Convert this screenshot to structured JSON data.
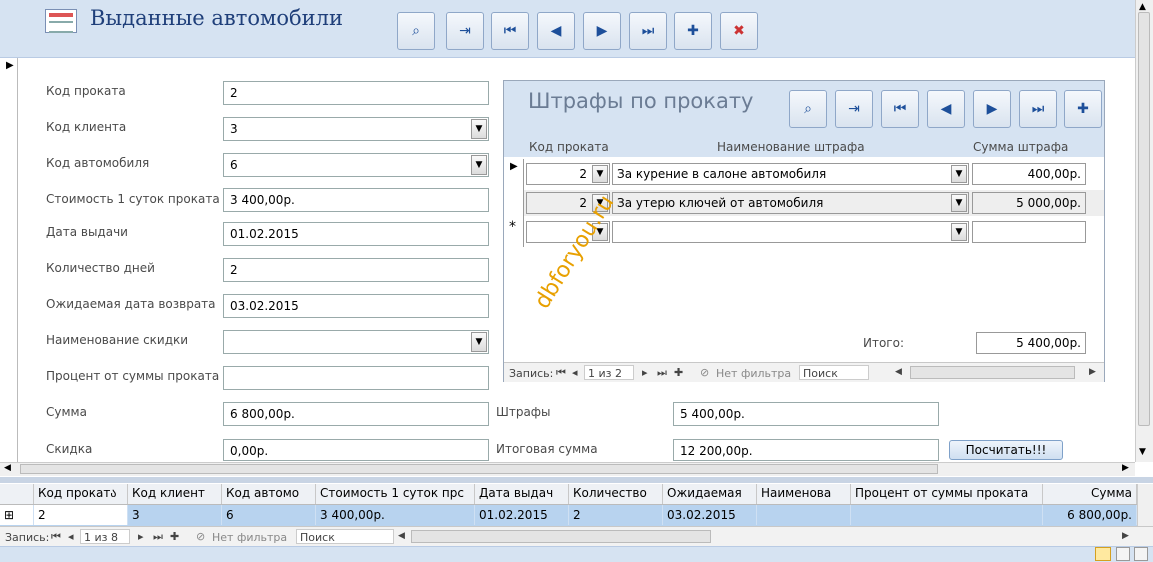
{
  "form": {
    "title": "Выданные автомобили",
    "toolbar": [
      "find-icon",
      "find-next-icon",
      "first-record-icon",
      "prev-record-icon",
      "next-record-icon",
      "last-record-icon",
      "new-record-icon",
      "delete-record-icon"
    ],
    "fields": {
      "rental_code_label": "Код проката",
      "rental_code_value": "2",
      "client_code_label": "Код клиента",
      "client_code_value": "3",
      "car_code_label": "Код автомобиля",
      "car_code_value": "6",
      "daily_cost_label": "Стоимость 1 суток проката",
      "daily_cost_value": "3 400,00р.",
      "issue_date_label": "Дата выдачи",
      "issue_date_value": "01.02.2015",
      "days_label": "Количество дней",
      "days_value": "2",
      "return_date_label": "Ожидаемая дата возврата",
      "return_date_value": "03.02.2015",
      "discount_name_label": "Наименование скидки",
      "discount_name_value": "",
      "percent_label": "Процент от суммы проката",
      "percent_value": "",
      "sum_label": "Сумма",
      "sum_value": "6 800,00р.",
      "discount_label": "Скидка",
      "discount_value": "0,00р.",
      "fines_label": "Штрафы",
      "fines_value": "5 400,00р.",
      "total_label": "Итоговая сумма",
      "total_value": "12 200,00р.",
      "calc_button": "Посчитать!!!"
    }
  },
  "subform": {
    "title": "Штрафы по прокату",
    "col_code": "Код проката",
    "col_name": "Наименование штрафа",
    "col_sum": "Сумма штрафа",
    "rows": [
      {
        "code": "2",
        "name": "За курение в салоне автомобиля",
        "sum": "400,00р."
      },
      {
        "code": "2",
        "name": "За утерю ключей от автомобиля",
        "sum": "5 000,00р."
      }
    ],
    "new_row_marker": "*",
    "total_label": "Итого:",
    "total_value": "5 400,00р.",
    "nav": {
      "record_label": "Запись:",
      "position": "1 из 2",
      "filter": "Нет фильтра",
      "search": "Поиск"
    }
  },
  "watermark": "dbforyou.ru",
  "grid": {
    "headers": [
      "Код прокатა",
      "Код клиент",
      "Код автомо",
      "Стоимость 1 суток прс",
      "Дата выдач",
      "Количество",
      "Ожидаемая",
      "Наименова",
      "Процент от суммы проката",
      "Сумма"
    ],
    "row": [
      "2",
      "3",
      "6",
      "3 400,00р.",
      "01.02.2015",
      "2",
      "03.02.2015",
      "",
      "",
      "6 800,00р."
    ],
    "nav": {
      "record_label": "Запись:",
      "position": "1 из 8",
      "filter": "Нет фильтра",
      "search": "Поиск"
    }
  },
  "colors": {
    "header_bg": "#d6e3f2",
    "selected_row": "#b8d3ef",
    "watermark": "#e8a000"
  }
}
